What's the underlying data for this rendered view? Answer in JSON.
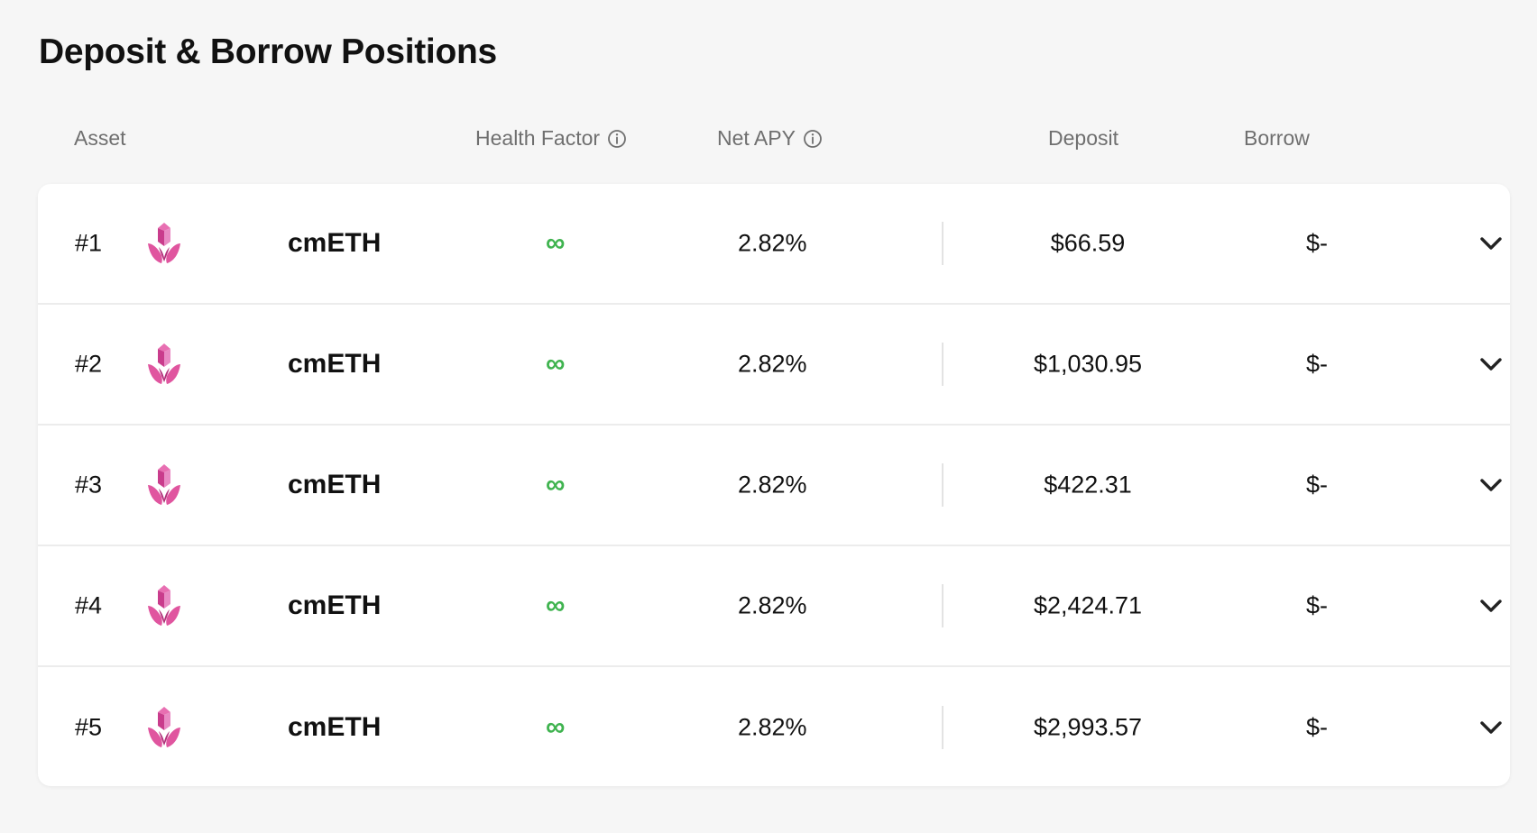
{
  "page": {
    "title": "Deposit & Borrow Positions"
  },
  "columns": {
    "asset": "Asset",
    "health_factor": "Health Factor",
    "net_apy": "Net APY",
    "deposit": "Deposit",
    "borrow": "Borrow"
  },
  "icons": {
    "info": "info-circle-icon",
    "asset_logo": "cmeth-logo-icon",
    "expand": "chevron-down-icon"
  },
  "colors": {
    "health_good": "#3fb34f",
    "logo_pink": "#e0559f",
    "logo_dark": "#b12f7a"
  },
  "positions": [
    {
      "rank": "#1",
      "symbol": "cmETH",
      "health_factor": "∞",
      "net_apy": "2.82%",
      "deposit": "$66.59",
      "borrow": "$-"
    },
    {
      "rank": "#2",
      "symbol": "cmETH",
      "health_factor": "∞",
      "net_apy": "2.82%",
      "deposit": "$1,030.95",
      "borrow": "$-"
    },
    {
      "rank": "#3",
      "symbol": "cmETH",
      "health_factor": "∞",
      "net_apy": "2.82%",
      "deposit": "$422.31",
      "borrow": "$-"
    },
    {
      "rank": "#4",
      "symbol": "cmETH",
      "health_factor": "∞",
      "net_apy": "2.82%",
      "deposit": "$2,424.71",
      "borrow": "$-"
    },
    {
      "rank": "#5",
      "symbol": "cmETH",
      "health_factor": "∞",
      "net_apy": "2.82%",
      "deposit": "$2,993.57",
      "borrow": "$-"
    }
  ]
}
